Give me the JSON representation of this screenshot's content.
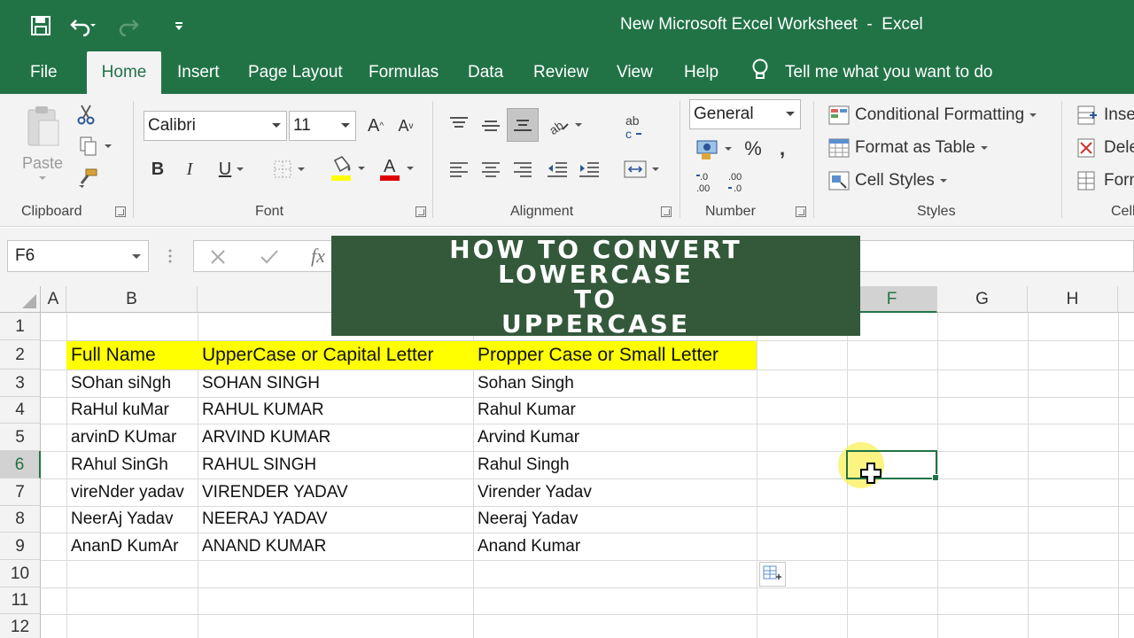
{
  "window": {
    "title": "New Microsoft Excel Worksheet  -  Excel"
  },
  "tabs": [
    "File",
    "Home",
    "Insert",
    "Page Layout",
    "Formulas",
    "Data",
    "Review",
    "View",
    "Help"
  ],
  "active_tab": "Home",
  "tell_me": "Tell me what you want to do",
  "ribbon": {
    "clipboard": {
      "label": "Clipboard",
      "paste": "Paste"
    },
    "font": {
      "label": "Font",
      "font_name": "Calibri",
      "font_size": "11"
    },
    "alignment": {
      "label": "Alignment"
    },
    "number": {
      "label": "Number",
      "format": "General"
    },
    "styles": {
      "label": "Styles",
      "conditional": "Conditional Formatting",
      "format_table": "Format as Table",
      "cell_styles": "Cell Styles"
    },
    "cells": {
      "label": "Cell",
      "insert": "Inse",
      "delete": "Dele",
      "format": "Forn"
    }
  },
  "formula_bar": {
    "name_box": "F6",
    "fx": "fx"
  },
  "banner": {
    "lines": [
      "HOW TO CONVERT",
      "LOWERCASE",
      "TO",
      "UPPERCASE"
    ]
  },
  "columns": [
    "A",
    "B",
    "F",
    "G",
    "H"
  ],
  "rows": [
    "1",
    "2",
    "3",
    "4",
    "5",
    "6",
    "7",
    "8",
    "9",
    "10",
    "11",
    "12"
  ],
  "table": {
    "headers": [
      "Full Name",
      "UpperCase or Capital Letter",
      "Propper Case or Small Letter"
    ],
    "rows": [
      [
        "SOhan siNgh",
        "SOHAN SINGH",
        "Sohan Singh"
      ],
      [
        "RaHul kuMar",
        "RAHUL KUMAR",
        "Rahul Kumar"
      ],
      [
        "arvinD KUmar",
        "ARVIND KUMAR",
        "Arvind Kumar"
      ],
      [
        "RAhul SinGh",
        "RAHUL SINGH",
        "Rahul Singh"
      ],
      [
        "vireNder yadav",
        "VIRENDER YADAV",
        "Virender Yadav"
      ],
      [
        "NeerAj Yadav",
        "NEERAJ YADAV",
        "Neeraj Yadav"
      ],
      [
        "AnanD KumAr",
        "ANAND KUMAR",
        "Anand Kumar"
      ]
    ]
  },
  "colors": {
    "excel_green": "#217346",
    "header_fill": "#ffff00"
  }
}
